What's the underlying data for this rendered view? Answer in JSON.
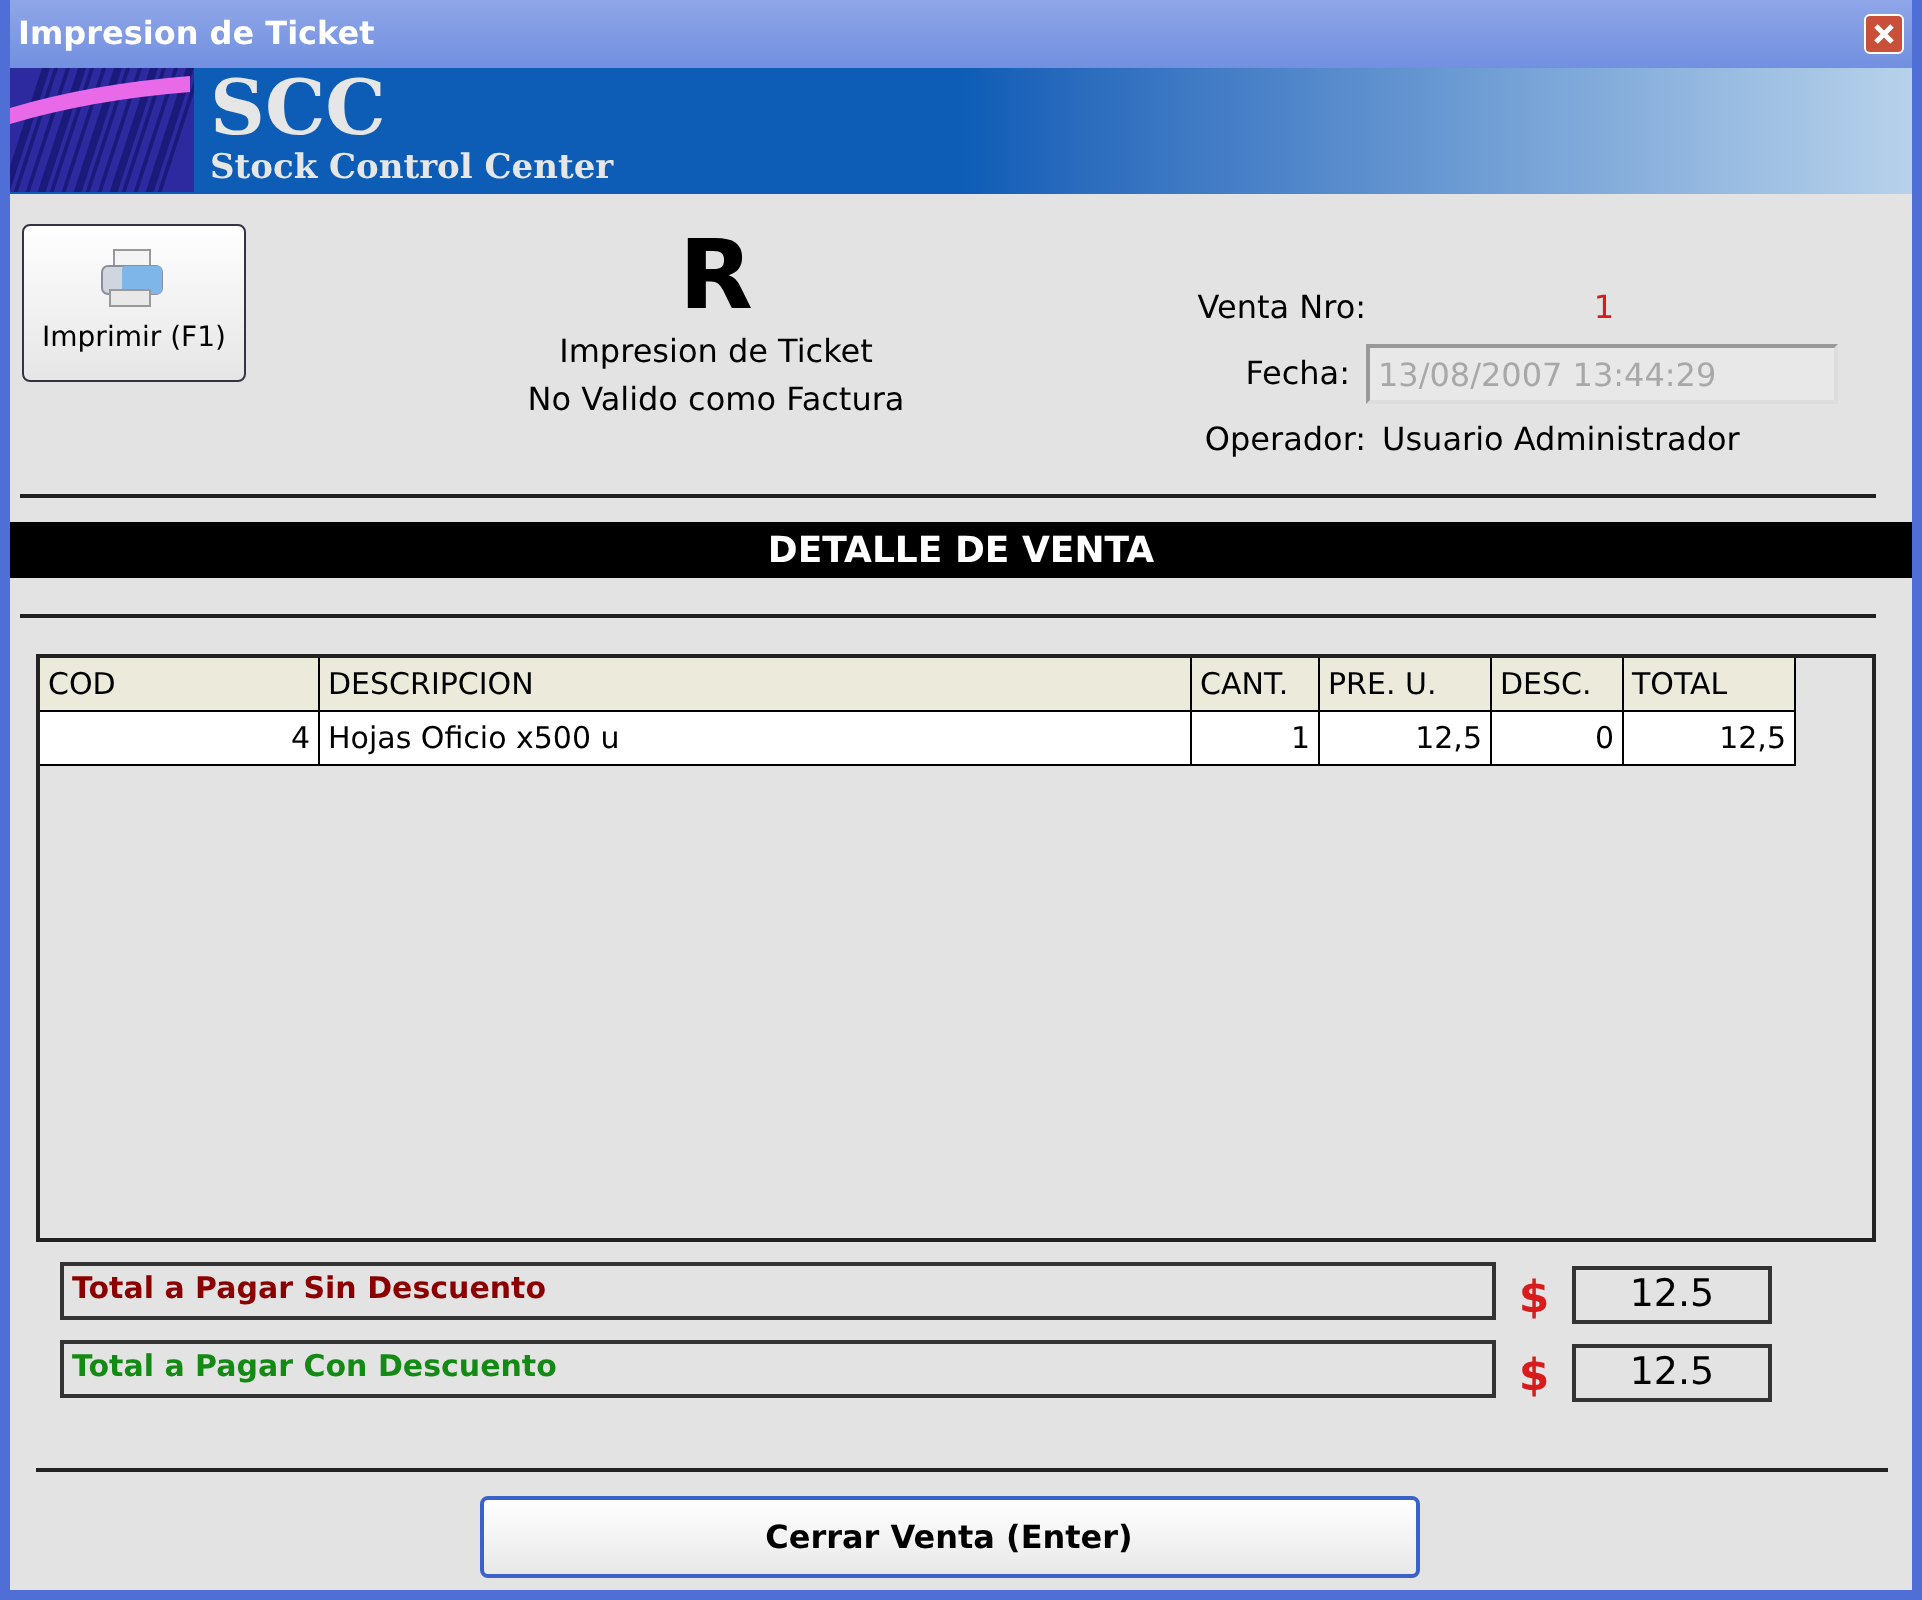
{
  "window": {
    "title": "Impresion de Ticket"
  },
  "banner": {
    "logo": "SCC",
    "subtitle": "Stock Control Center"
  },
  "print_button": {
    "label": "Imprimir (F1)"
  },
  "ticket": {
    "letter": "R",
    "line_1": "Impresion de Ticket",
    "line_2": "No Valido como Factura"
  },
  "info": {
    "sale_label": "Venta Nro:",
    "sale_number": "1",
    "date_label": "Fecha:",
    "date_value": "13/08/2007 13:44:29",
    "operator_label": "Operador:",
    "operator_value": "Usuario Administrador"
  },
  "section_title": "DETALLE DE VENTA",
  "table": {
    "columns": [
      "COD",
      "DESCRIPCION",
      "CANT.",
      "PRE. U.",
      "DESC.",
      "TOTAL"
    ],
    "rows": [
      [
        "4",
        "Hojas Oficio x500 u",
        "1",
        "12,5",
        "0",
        "12,5"
      ]
    ]
  },
  "totals": [
    {
      "label": "Total a Pagar Sin Descuento",
      "color": "#8b0000",
      "currency": "$",
      "value": "12.5"
    },
    {
      "label": "Total a Pagar Con Descuento",
      "color": "#138a13",
      "currency": "$",
      "value": "12.5"
    }
  ],
  "close_button": {
    "label": "Cerrar Venta (Enter)"
  }
}
